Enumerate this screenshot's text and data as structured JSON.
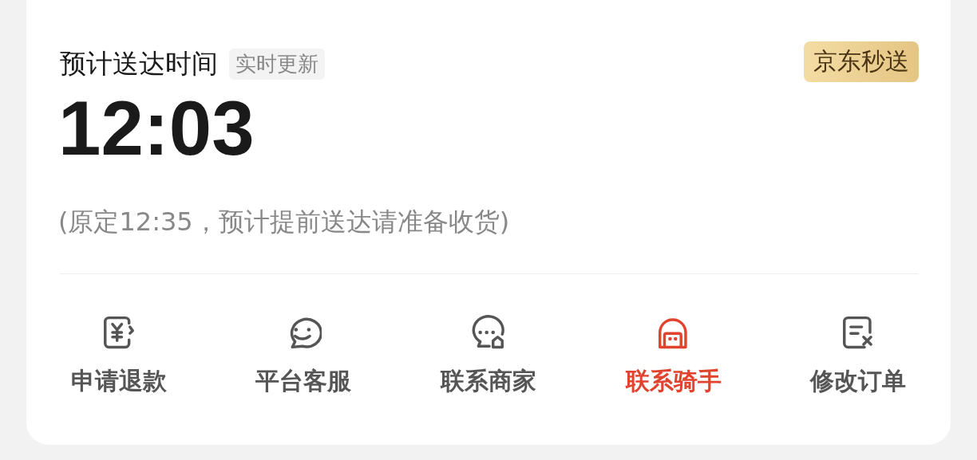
{
  "header": {
    "title": "预计送达时间",
    "tag": "实时更新",
    "badge": "京东秒送"
  },
  "eta": "12:03",
  "note": "(原定12:35，预计提前送达请准备收货)",
  "actions": [
    {
      "kind": "refund",
      "label": "申请退款",
      "highlighted": false
    },
    {
      "kind": "service",
      "label": "平台客服",
      "highlighted": false
    },
    {
      "kind": "merchant",
      "label": "联系商家",
      "highlighted": false
    },
    {
      "kind": "rider",
      "label": "联系骑手",
      "highlighted": true
    },
    {
      "kind": "edit",
      "label": "修改订单",
      "highlighted": false
    }
  ]
}
